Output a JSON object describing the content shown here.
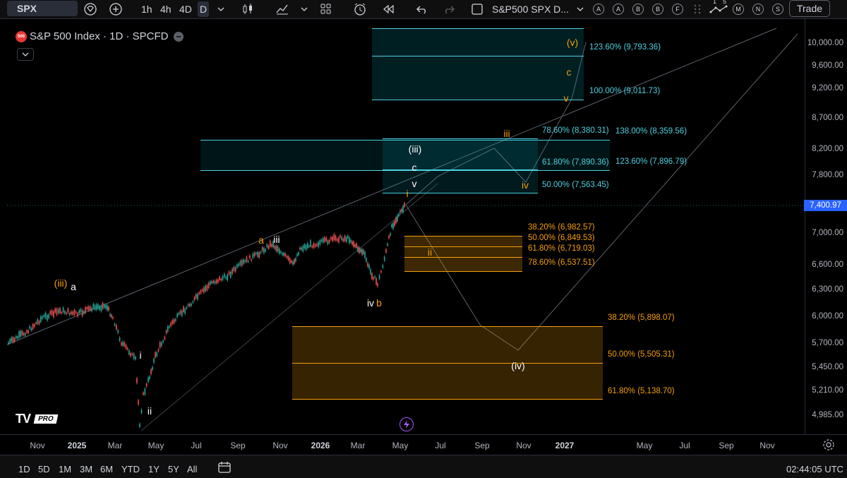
{
  "toolbar": {
    "symbol": "SPX",
    "timeframes": [
      "1h",
      "4h",
      "4D",
      "D"
    ],
    "compare_label": "S&P500 SPX D...",
    "alerts": [
      "A",
      "A",
      "B",
      "B",
      "F"
    ],
    "right_circles": [
      "M",
      "N",
      "S"
    ],
    "indicator_count": "1",
    "indicator_count2": "5",
    "trade_label": "Trade"
  },
  "legend": {
    "badge": "500",
    "title": "S&P 500 Index · 1D · SPCFD"
  },
  "price_axis": {
    "labels": [
      "10,000.00",
      "9,600.00",
      "9,200.00",
      "8,700.00",
      "8,200.00",
      "7,800.00",
      "7,400.97",
      "7,000.00",
      "6,600.00",
      "6,300.00",
      "6,000.00",
      "5,700.00",
      "5,450.00",
      "5,210.00",
      "4,985.00"
    ],
    "current_price": "7,400.97"
  },
  "time_axis": {
    "labels": [
      {
        "t": "Nov",
        "bold": false
      },
      {
        "t": "2025",
        "bold": true
      },
      {
        "t": "Mar",
        "bold": false
      },
      {
        "t": "May",
        "bold": false
      },
      {
        "t": "Jul",
        "bold": false
      },
      {
        "t": "Sep",
        "bold": false
      },
      {
        "t": "Nov",
        "bold": false
      },
      {
        "t": "2026",
        "bold": true
      },
      {
        "t": "Mar",
        "bold": false
      },
      {
        "t": "May",
        "bold": false
      },
      {
        "t": "Jul",
        "bold": false
      },
      {
        "t": "Sep",
        "bold": false
      },
      {
        "t": "Nov",
        "bold": false
      },
      {
        "t": "2027",
        "bold": true
      },
      {
        "t": "May",
        "bold": false
      },
      {
        "t": "Jul",
        "bold": false
      },
      {
        "t": "Sep",
        "bold": false
      },
      {
        "t": "Nov",
        "bold": false
      }
    ]
  },
  "bottom_bar": {
    "ranges": [
      "1D",
      "5D",
      "1M",
      "3M",
      "6M",
      "YTD",
      "1Y",
      "5Y",
      "All"
    ],
    "clock": "02:44:05 UTC"
  },
  "fib_levels": {
    "upper_cyan": [
      "123.60% (9,793.36)",
      "100.00% (9,011.73)"
    ],
    "mid_cyan_left": [
      "78.60% (8,380.31)",
      "61.80% (7,890.36)",
      "50.00% (7,563.45)"
    ],
    "mid_cyan_right": [
      "138.00% (8,359.56)",
      "123.60% (7,896.79)"
    ],
    "orange_small": [
      "38.20% (6,982.57)",
      "50.00% (6,849.53)",
      "61.80% (6,719.03)",
      "78.60% (6,537.51)"
    ],
    "orange_big": [
      "38.20% (5,898.07)",
      "50.00% (5,505.31)",
      "61.80% (5,138.70)"
    ]
  },
  "wave_labels": {
    "iiia": "(iii)",
    "a_small": "a",
    "i1": "i",
    "ii1": "ii",
    "a2": "a",
    "iii2": "iii",
    "iv": "iv",
    "b": "b",
    "iii_paren": "(iii)",
    "c1": "c",
    "v1": "v",
    "i_orange": "i",
    "ii_orange": "ii",
    "iii_orange": "iii",
    "iv_orange": "iv",
    "v_paren": "(v)",
    "c_orange": "c",
    "v_orange": "v",
    "iv_paren": "(iv)"
  },
  "watermark": {
    "brand": "TV",
    "tier": "PRO"
  },
  "colors": {
    "cyan": "#4dd0e1",
    "orange": "#f59e0b",
    "up": "#26a69a",
    "down": "#ef5350",
    "price_tag": "#2962ff"
  }
}
